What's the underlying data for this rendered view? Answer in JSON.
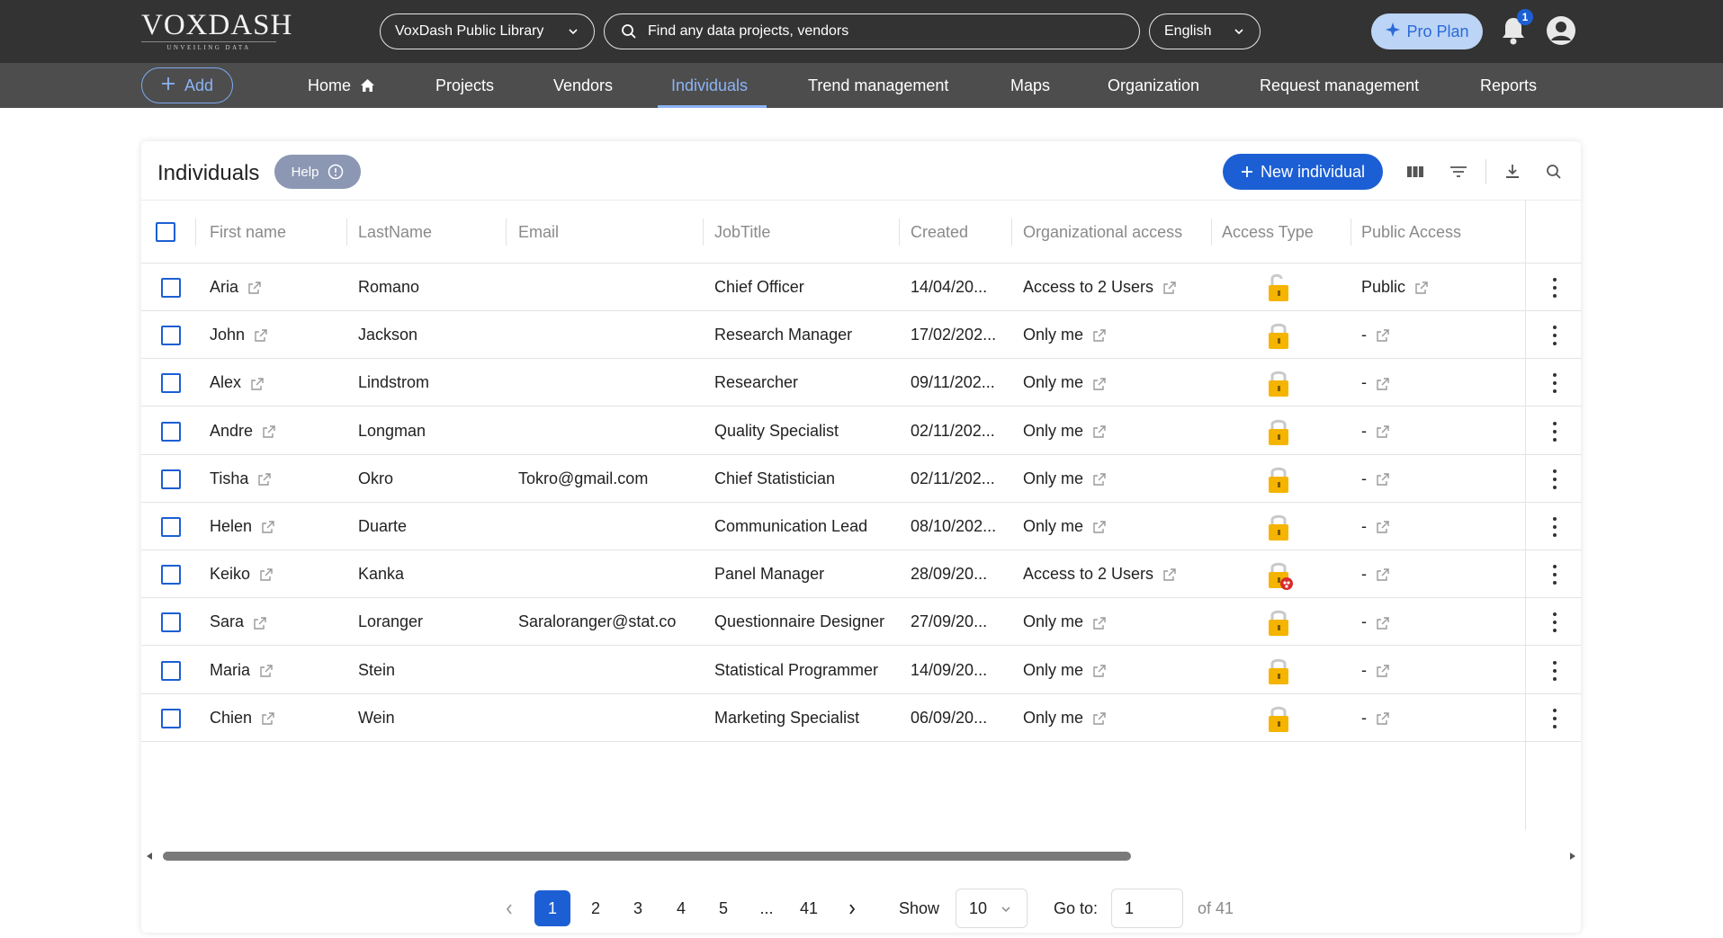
{
  "header": {
    "logo_word": "VOXDASH",
    "logo_tagline": "UNVEILING DATA",
    "library_select": "VoxDash Public Library",
    "search_placeholder": "Find any data projects, vendors",
    "language": "English",
    "pro_plan": "Pro Plan",
    "notification_count": "1"
  },
  "nav": {
    "add_label": "Add",
    "items": [
      "Home",
      "Projects",
      "Vendors",
      "Individuals",
      "Trend management",
      "Maps",
      "Organization",
      "Request management",
      "Reports"
    ],
    "active": "Individuals"
  },
  "page": {
    "title": "Individuals",
    "help_label": "Help",
    "new_button": "New individual"
  },
  "table": {
    "columns": [
      "First name",
      "LastName",
      "Email",
      "JobTitle",
      "Created",
      "Organizational access",
      "Access Type",
      "Public Access"
    ],
    "rows": [
      {
        "first": "Aria",
        "last": "Romano",
        "email": "",
        "job": "Chief Officer",
        "created": "14/04/20...",
        "org_access": "Access to 2 Users",
        "access_type": "shared-lock",
        "public": "Public"
      },
      {
        "first": "John",
        "last": "Jackson",
        "email": "",
        "job": "Research Manager",
        "created": "17/02/202...",
        "org_access": "Only me",
        "access_type": "lock",
        "public": "-"
      },
      {
        "first": "Alex",
        "last": "Lindstrom",
        "email": "",
        "job": "Researcher",
        "created": "09/11/202...",
        "org_access": "Only me",
        "access_type": "lock",
        "public": "-"
      },
      {
        "first": "Andre",
        "last": "Longman",
        "email": "",
        "job": "Quality Specialist",
        "created": "02/11/202...",
        "org_access": "Only me",
        "access_type": "lock",
        "public": "-"
      },
      {
        "first": "Tisha",
        "last": "Okro",
        "email": "Tokro@gmail.com",
        "job": "Chief Statistician",
        "created": "02/11/202...",
        "org_access": "Only me",
        "access_type": "lock",
        "public": "-"
      },
      {
        "first": "Helen",
        "last": "Duarte",
        "email": "",
        "job": "Communication Lead",
        "created": "08/10/202...",
        "org_access": "Only me",
        "access_type": "lock",
        "public": "-"
      },
      {
        "first": "Keiko",
        "last": "Kanka",
        "email": "",
        "job": "Panel Manager",
        "created": "28/09/20...",
        "org_access": "Access to 2 Users",
        "access_type": "group-lock",
        "public": "-"
      },
      {
        "first": "Sara",
        "last": "Loranger",
        "email": "Saraloranger@stat.co",
        "job": "Questionnaire Designer",
        "created": "27/09/20...",
        "org_access": "Only me",
        "access_type": "lock",
        "public": "-"
      },
      {
        "first": "Maria",
        "last": "Stein",
        "email": "",
        "job": "Statistical Programmer",
        "created": "14/09/20...",
        "org_access": "Only me",
        "access_type": "lock",
        "public": "-"
      },
      {
        "first": "Chien",
        "last": "Wein",
        "email": "",
        "job": "Marketing Specialist",
        "created": "06/09/20...",
        "org_access": "Only me",
        "access_type": "lock",
        "public": "-"
      }
    ]
  },
  "pagination": {
    "pages": [
      "1",
      "2",
      "3",
      "4",
      "5",
      "...",
      "41"
    ],
    "current": "1",
    "show_label": "Show",
    "show_value": "10",
    "goto_label": "Go to:",
    "goto_value": "1",
    "of_label": "of 41"
  },
  "colors": {
    "accent": "#1c5fd4",
    "topbar": "#333333",
    "navbar": "#4d4d4d",
    "lock": "#f5b400"
  }
}
